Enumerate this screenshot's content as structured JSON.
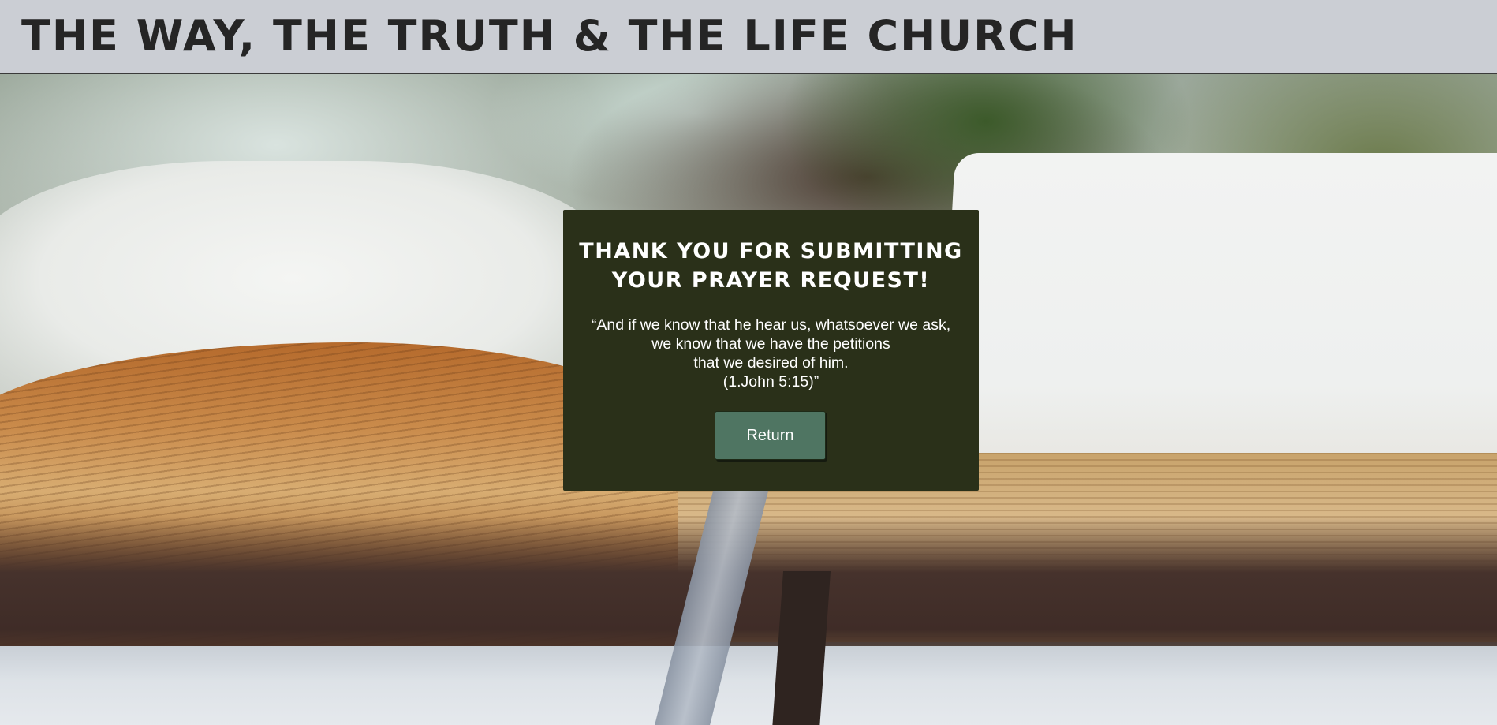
{
  "header": {
    "title": "THE WAY, THE TRUTH & THE LIFE CHURCH"
  },
  "confirmation": {
    "heading_line1": "THANK YOU FOR SUBMITTING",
    "heading_line2": "YOUR PRAYER REQUEST!",
    "verse_lines": [
      "“And if we know that he hear us, whatsoever we ask,",
      "we know that we have the petitions",
      "that we desired of him.",
      "(1.John 5:15)”"
    ],
    "return_label": "Return"
  },
  "colors": {
    "header_bg": "#cbced4",
    "card_bg": "#2a3019",
    "button_bg": "#4f7562",
    "text_light": "#ffffff",
    "title_text": "#252525"
  }
}
